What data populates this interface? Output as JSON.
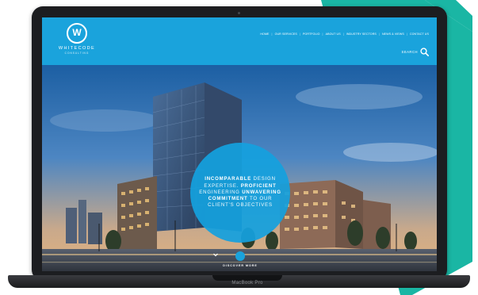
{
  "site": {
    "logo_initial": "W",
    "logo_name": "WHITECODE",
    "logo_sub": "CONSULTING"
  },
  "nav": {
    "items": [
      "HOME",
      "OUR SERVICES",
      "PORTFOLIO",
      "ABOUT US",
      "INDUSTRY SECTORS",
      "NEWS & VIEWS",
      "CONTACT US"
    ]
  },
  "search": {
    "label": "SEARCH"
  },
  "hero": {
    "w1": "INCOMPARABLE",
    "w2": "DESIGN",
    "w3": "EXPERTISE.",
    "w4": "PROFICIENT",
    "w5": "ENGINEERING",
    "w6": "UNWAVERING",
    "w7": "COMMITMENT",
    "w8": "TO OUR",
    "w9": "CLIENT'S OBJECTIVES"
  },
  "discover": {
    "label": "DISCOVER MORE"
  },
  "laptop": {
    "brand": "MacBook Pro"
  },
  "colors": {
    "brand_blue": "#1aa3dc",
    "teal": "#1ab6a4",
    "laptop_body": "#1c1d20"
  },
  "icons": {
    "logo": "w-circle-logo",
    "search": "magnifier-icon",
    "discover": "chevron-down-circle-icon"
  }
}
